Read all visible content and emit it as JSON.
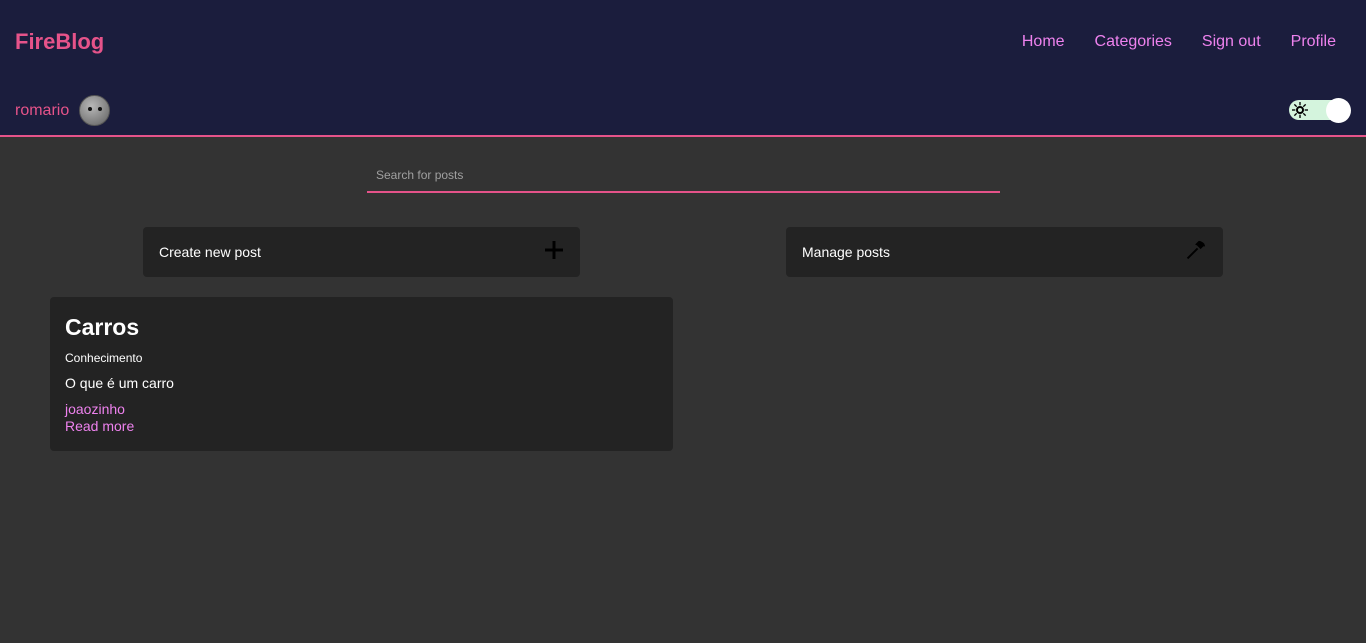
{
  "header": {
    "brand": "FireBlog",
    "nav": [
      {
        "label": "Home"
      },
      {
        "label": "Categories"
      },
      {
        "label": "Sign out"
      },
      {
        "label": "Profile"
      }
    ],
    "user": {
      "name": "romario"
    },
    "theme_toggle": {
      "icon": "sun-icon",
      "state": "on"
    }
  },
  "search": {
    "placeholder": "Search for posts",
    "value": ""
  },
  "actions": {
    "create": {
      "label": "Create new post",
      "icon": "plus-icon"
    },
    "manage": {
      "label": "Manage posts",
      "icon": "hammer-icon"
    }
  },
  "posts": [
    {
      "title": "Carros",
      "category": "Conhecimento",
      "description": "O que é um carro",
      "author": "joaozinho",
      "read_more": "Read more"
    }
  ],
  "colors": {
    "header_bg": "#1b1d3d",
    "accent": "#e6538a",
    "link": "#ee82ee",
    "page_bg": "#333333",
    "card_bg": "#232323"
  }
}
